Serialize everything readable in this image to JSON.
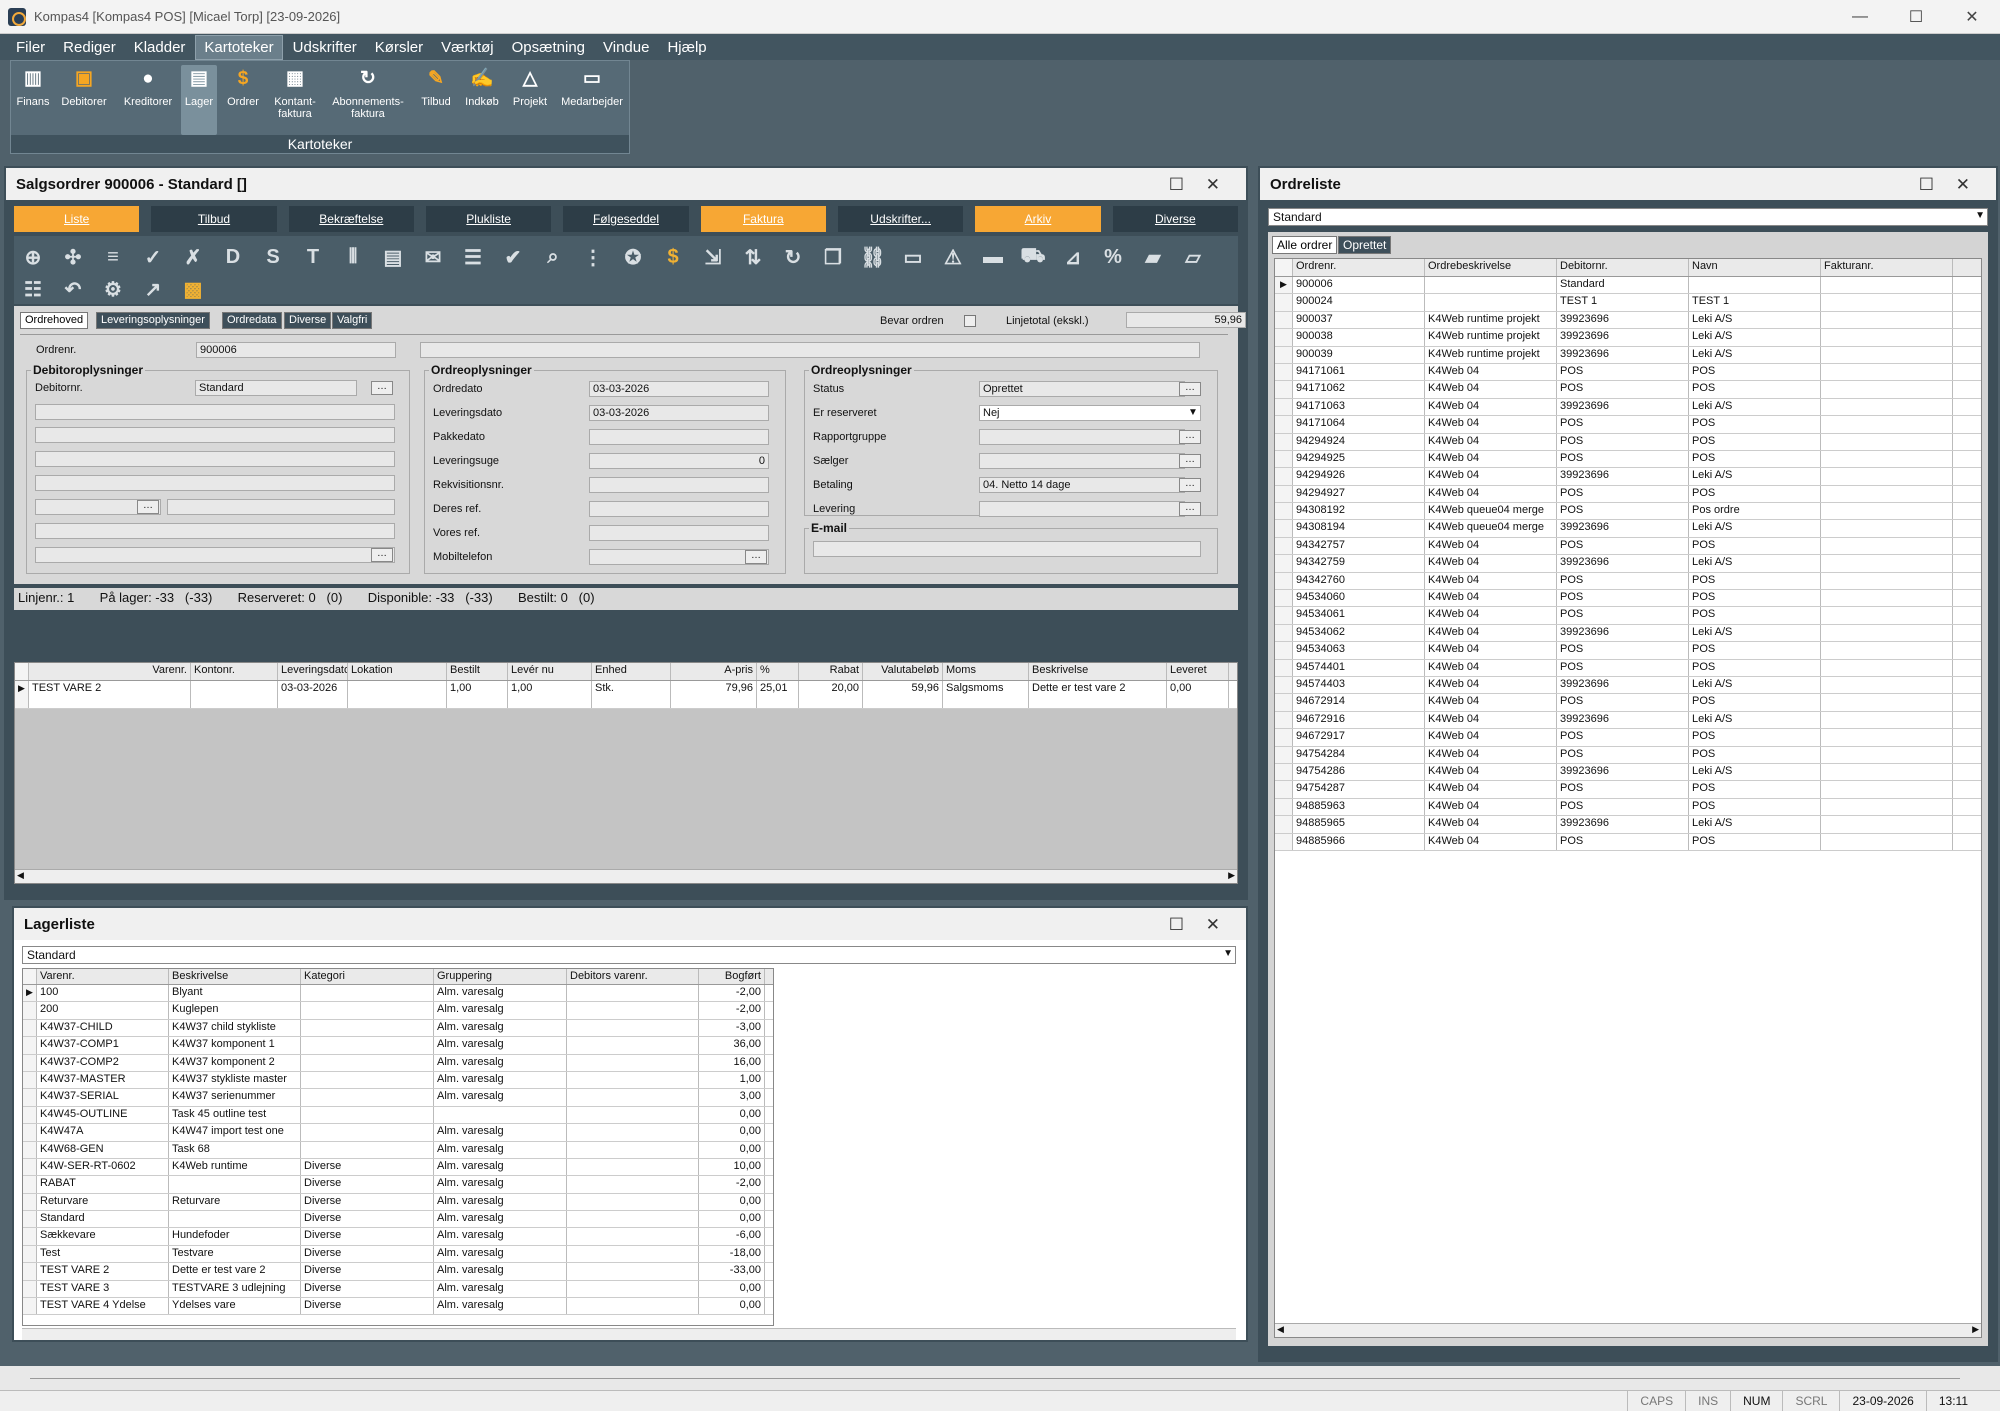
{
  "titlebar": {
    "title": "Kompas4  [Kompas4 POS]  [Micael Torp]  [23-09-2026]",
    "min": "—",
    "max": "☐",
    "close": "✕"
  },
  "menu": [
    "Filer",
    "Rediger",
    "Kladder",
    "Kartoteker",
    "Udskrifter",
    "Kørsler",
    "Værktøj",
    "Opsætning",
    "Vindue",
    "Hjælp"
  ],
  "ribbon": {
    "group_label": "Kartoteker",
    "buttons": [
      {
        "label": "Finans",
        "icon": "books-icon"
      },
      {
        "label": "Debitorer",
        "icon": "debitor-icon"
      },
      {
        "label": "Kreditorer",
        "icon": "person-icon"
      },
      {
        "label": "Lager",
        "icon": "warehouse-icon"
      },
      {
        "label": "Ordrer",
        "icon": "money-bag-icon"
      },
      {
        "label": "Kontant-\nfaktura",
        "icon": "register-icon"
      },
      {
        "label": "Abonnements-\nfaktura",
        "icon": "refresh-icon"
      },
      {
        "label": "Tilbud",
        "icon": "offer-icon"
      },
      {
        "label": "Indkøb",
        "icon": "purchase-icon"
      },
      {
        "label": "Projekt",
        "icon": "project-icon"
      },
      {
        "label": "Medarbejder",
        "icon": "employee-icon"
      }
    ]
  },
  "salesorder": {
    "title": "Salgsordrer  900006 - Standard []",
    "tabs": [
      "Liste",
      "Tilbud",
      "Bekræftelse",
      "Plukliste",
      "Følgeseddel",
      "Faktura",
      "Udskrifter...",
      "Arkiv",
      "Diverse"
    ],
    "subtabs": [
      "Ordrehoved",
      "Leveringsoplysninger",
      "Ordredata",
      "Diverse",
      "Valgfri"
    ],
    "bevar_label": "Bevar ordren",
    "linjetotal_label": "Linjetotal (ekskl.)",
    "linjetotal": "59,96",
    "ordrenr_label": "Ordrenr.",
    "ordrenr": "900006",
    "debitor_group": "Debitoroplysninger",
    "debitornr_label": "Debitornr.",
    "debitornr": "Standard",
    "order_group1": "Ordreoplysninger",
    "order_group2": "Ordreoplysninger",
    "fields_mid": [
      {
        "label": "Ordredato",
        "value": "03-03-2026"
      },
      {
        "label": "Leveringsdato",
        "value": "03-03-2026"
      },
      {
        "label": "Pakkedato",
        "value": ""
      },
      {
        "label": "Leveringsuge",
        "value": "0"
      },
      {
        "label": "Rekvisitionsnr.",
        "value": ""
      },
      {
        "label": "Deres ref.",
        "value": ""
      },
      {
        "label": "Vores ref.",
        "value": ""
      },
      {
        "label": "Mobiltelefon",
        "value": ""
      }
    ],
    "fields_right": [
      {
        "label": "Status",
        "value": "Oprettet"
      },
      {
        "label": "Er reserveret",
        "value": "Nej"
      },
      {
        "label": "Rapportgruppe",
        "value": ""
      },
      {
        "label": "Sælger",
        "value": ""
      },
      {
        "label": "Betaling",
        "value": "04. Netto 14 dage"
      },
      {
        "label": "Levering",
        "value": ""
      }
    ],
    "email_label": "E-mail",
    "infoline": "Linjenr.: 1       På lager: -33   (-33)       Reserveret: 0   (0)       Disponible: -33   (-33)       Bestilt: 0   (0)",
    "lines_cols": [
      "Varenr.",
      "Kontonr.",
      "Leveringsdato",
      "Lokation",
      "Bestilt",
      "Levér nu",
      "Enhed",
      "A-pris",
      "%",
      "Rabat",
      "Valutabeløb",
      "Moms",
      "Beskrivelse",
      "Leveret"
    ],
    "lines": [
      [
        "TEST VARE 2",
        "",
        "03-03-2026",
        "",
        "1,00",
        "1,00",
        "Stk.",
        "79,96",
        "25,01",
        "20,00",
        "59,96",
        "Salgsmoms",
        "Dette er test vare 2",
        "0,00"
      ]
    ]
  },
  "lagerliste": {
    "title": "Lagerliste",
    "combo": "Standard",
    "cols": [
      "Varenr.",
      "Beskrivelse",
      "Kategori",
      "Gruppering",
      "Debitors varenr.",
      "Bogført"
    ],
    "rows": [
      [
        "100",
        "Blyant",
        "",
        "Alm. varesalg",
        "",
        "-2,00"
      ],
      [
        "200",
        "Kuglepen",
        "",
        "Alm. varesalg",
        "",
        "-2,00"
      ],
      [
        "K4W37-CHILD",
        "K4W37 child stykliste",
        "",
        "Alm. varesalg",
        "",
        "-3,00"
      ],
      [
        "K4W37-COMP1",
        "K4W37 komponent 1",
        "",
        "Alm. varesalg",
        "",
        "36,00"
      ],
      [
        "K4W37-COMP2",
        "K4W37 komponent 2",
        "",
        "Alm. varesalg",
        "",
        "16,00"
      ],
      [
        "K4W37-MASTER",
        "K4W37 stykliste master",
        "",
        "Alm. varesalg",
        "",
        "1,00"
      ],
      [
        "K4W37-SERIAL",
        "K4W37 serienummer",
        "",
        "Alm. varesalg",
        "",
        "3,00"
      ],
      [
        "K4W45-OUTLINE",
        "Task 45 outline test",
        "",
        "",
        "",
        "0,00"
      ],
      [
        "K4W47A",
        "K4W47 import test one",
        "",
        "Alm. varesalg",
        "",
        "0,00"
      ],
      [
        "K4W68-GEN",
        "Task 68",
        "",
        "Alm. varesalg",
        "",
        "0,00"
      ],
      [
        "K4W-SER-RT-0602",
        "K4Web runtime",
        "Diverse",
        "Alm. varesalg",
        "",
        "10,00"
      ],
      [
        "RABAT",
        "",
        "Diverse",
        "Alm. varesalg",
        "",
        "-2,00"
      ],
      [
        "Returvare",
        "Returvare",
        "Diverse",
        "Alm. varesalg",
        "",
        "0,00"
      ],
      [
        "Standard",
        "",
        "Diverse",
        "Alm. varesalg",
        "",
        "0,00"
      ],
      [
        "Sækkevare",
        "Hundefoder",
        "Diverse",
        "Alm. varesalg",
        "",
        "-6,00"
      ],
      [
        "Test",
        "Testvare",
        "Diverse",
        "Alm. varesalg",
        "",
        "-18,00"
      ],
      [
        "TEST VARE 2",
        "Dette er test vare 2",
        "Diverse",
        "Alm. varesalg",
        "",
        "-33,00"
      ],
      [
        "TEST VARE 3",
        "TESTVARE 3 udlejning",
        "Diverse",
        "Alm. varesalg",
        "",
        "0,00"
      ],
      [
        "TEST VARE 4 Ydelse",
        "Ydelses vare",
        "Diverse",
        "Alm. varesalg",
        "",
        "0,00"
      ]
    ]
  },
  "ordreliste": {
    "title": "Ordreliste",
    "combo": "Standard",
    "tabs": [
      "Alle ordrer",
      "Oprettet"
    ],
    "cols": [
      "Ordrenr.",
      "Ordrebeskrivelse",
      "Debitornr.",
      "Navn",
      "Fakturanr."
    ],
    "rows": [
      [
        "900006",
        "",
        "Standard",
        "",
        ""
      ],
      [
        "900024",
        "",
        "TEST 1",
        "TEST 1",
        ""
      ],
      [
        "900037",
        "K4Web runtime projekt",
        "39923696",
        "Leki A/S",
        ""
      ],
      [
        "900038",
        "K4Web runtime projekt",
        "39923696",
        "Leki A/S",
        ""
      ],
      [
        "900039",
        "K4Web runtime projekt",
        "39923696",
        "Leki A/S",
        ""
      ],
      [
        "94171061",
        "K4Web 04",
        "POS",
        "POS",
        ""
      ],
      [
        "94171062",
        "K4Web 04",
        "POS",
        "POS",
        ""
      ],
      [
        "94171063",
        "K4Web 04",
        "39923696",
        "Leki A/S",
        ""
      ],
      [
        "94171064",
        "K4Web 04",
        "POS",
        "POS",
        ""
      ],
      [
        "94294924",
        "K4Web 04",
        "POS",
        "POS",
        ""
      ],
      [
        "94294925",
        "K4Web 04",
        "POS",
        "POS",
        ""
      ],
      [
        "94294926",
        "K4Web 04",
        "39923696",
        "Leki A/S",
        ""
      ],
      [
        "94294927",
        "K4Web 04",
        "POS",
        "POS",
        ""
      ],
      [
        "94308192",
        "K4Web queue04 merge",
        "POS",
        "Pos ordre",
        ""
      ],
      [
        "94308194",
        "K4Web queue04 merge",
        "39923696",
        "Leki A/S",
        ""
      ],
      [
        "94342757",
        "K4Web 04",
        "POS",
        "POS",
        ""
      ],
      [
        "94342759",
        "K4Web 04",
        "39923696",
        "Leki A/S",
        ""
      ],
      [
        "94342760",
        "K4Web 04",
        "POS",
        "POS",
        ""
      ],
      [
        "94534060",
        "K4Web 04",
        "POS",
        "POS",
        ""
      ],
      [
        "94534061",
        "K4Web 04",
        "POS",
        "POS",
        ""
      ],
      [
        "94534062",
        "K4Web 04",
        "39923696",
        "Leki A/S",
        ""
      ],
      [
        "94534063",
        "K4Web 04",
        "POS",
        "POS",
        ""
      ],
      [
        "94574401",
        "K4Web 04",
        "POS",
        "POS",
        ""
      ],
      [
        "94574403",
        "K4Web 04",
        "39923696",
        "Leki A/S",
        ""
      ],
      [
        "94672914",
        "K4Web 04",
        "POS",
        "POS",
        ""
      ],
      [
        "94672916",
        "K4Web 04",
        "39923696",
        "Leki A/S",
        ""
      ],
      [
        "94672917",
        "K4Web 04",
        "POS",
        "POS",
        ""
      ],
      [
        "94754284",
        "K4Web 04",
        "POS",
        "POS",
        ""
      ],
      [
        "94754286",
        "K4Web 04",
        "39923696",
        "Leki A/S",
        ""
      ],
      [
        "94754287",
        "K4Web 04",
        "POS",
        "POS",
        ""
      ],
      [
        "94885963",
        "K4Web 04",
        "POS",
        "POS",
        ""
      ],
      [
        "94885965",
        "K4Web 04",
        "39923696",
        "Leki A/S",
        ""
      ],
      [
        "94885966",
        "K4Web 04",
        "POS",
        "POS",
        ""
      ]
    ]
  },
  "statusbar": [
    "CAPS",
    "INS",
    "NUM",
    "SCRL",
    "23-09-2026",
    "13:11"
  ]
}
